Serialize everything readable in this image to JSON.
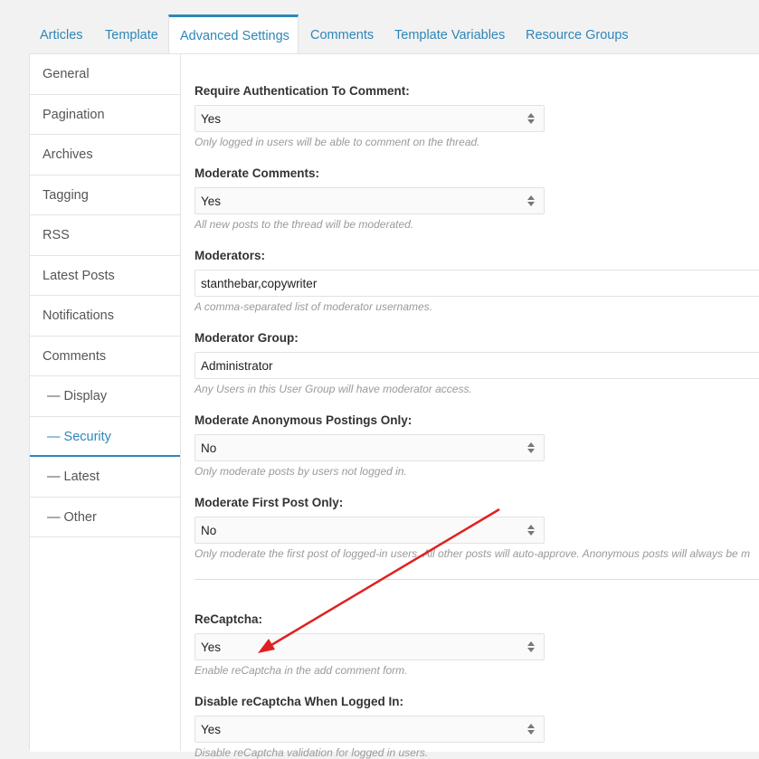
{
  "tabs": [
    {
      "label": "Articles"
    },
    {
      "label": "Template"
    },
    {
      "label": "Advanced Settings",
      "active": true
    },
    {
      "label": "Comments"
    },
    {
      "label": "Template Variables"
    },
    {
      "label": "Resource Groups"
    }
  ],
  "sidebar": {
    "items": [
      {
        "label": "General"
      },
      {
        "label": "Pagination"
      },
      {
        "label": "Archives"
      },
      {
        "label": "Tagging"
      },
      {
        "label": "RSS"
      },
      {
        "label": "Latest Posts"
      },
      {
        "label": "Notifications"
      },
      {
        "label": "Comments"
      },
      {
        "label": "— Display"
      },
      {
        "label": "— Security",
        "active": true
      },
      {
        "label": "— Latest"
      },
      {
        "label": "— Other"
      }
    ]
  },
  "form": {
    "require_auth": {
      "label": "Require Authentication To Comment:",
      "value": "Yes",
      "help": "Only logged in users will be able to comment on the thread."
    },
    "moderate_comments": {
      "label": "Moderate Comments:",
      "value": "Yes",
      "help": "All new posts to the thread will be moderated."
    },
    "moderators": {
      "label": "Moderators:",
      "value": "stanthebar,copywriter",
      "help": "A comma-separated list of moderator usernames."
    },
    "moderator_group": {
      "label": "Moderator Group:",
      "value": "Administrator",
      "help": "Any Users in this User Group will have moderator access."
    },
    "moderate_anonymous": {
      "label": "Moderate Anonymous Postings Only:",
      "value": "No",
      "help": "Only moderate posts by users not logged in."
    },
    "moderate_first": {
      "label": "Moderate First Post Only:",
      "value": "No",
      "help": "Only moderate the first post of logged-in users. All other posts will auto-approve. Anonymous posts will always be m"
    },
    "recaptcha": {
      "label": "ReCaptcha:",
      "value": "Yes",
      "help": "Enable reCaptcha in the add comment form."
    },
    "disable_recaptcha_logged_in": {
      "label": "Disable reCaptcha When Logged In:",
      "value": "Yes",
      "help": "Disable reCaptcha validation for logged in users."
    }
  },
  "colors": {
    "accent": "#2e86b8",
    "annotation_arrow": "#e02020"
  },
  "icons": {
    "select_arrows": "updown-arrows-icon"
  }
}
